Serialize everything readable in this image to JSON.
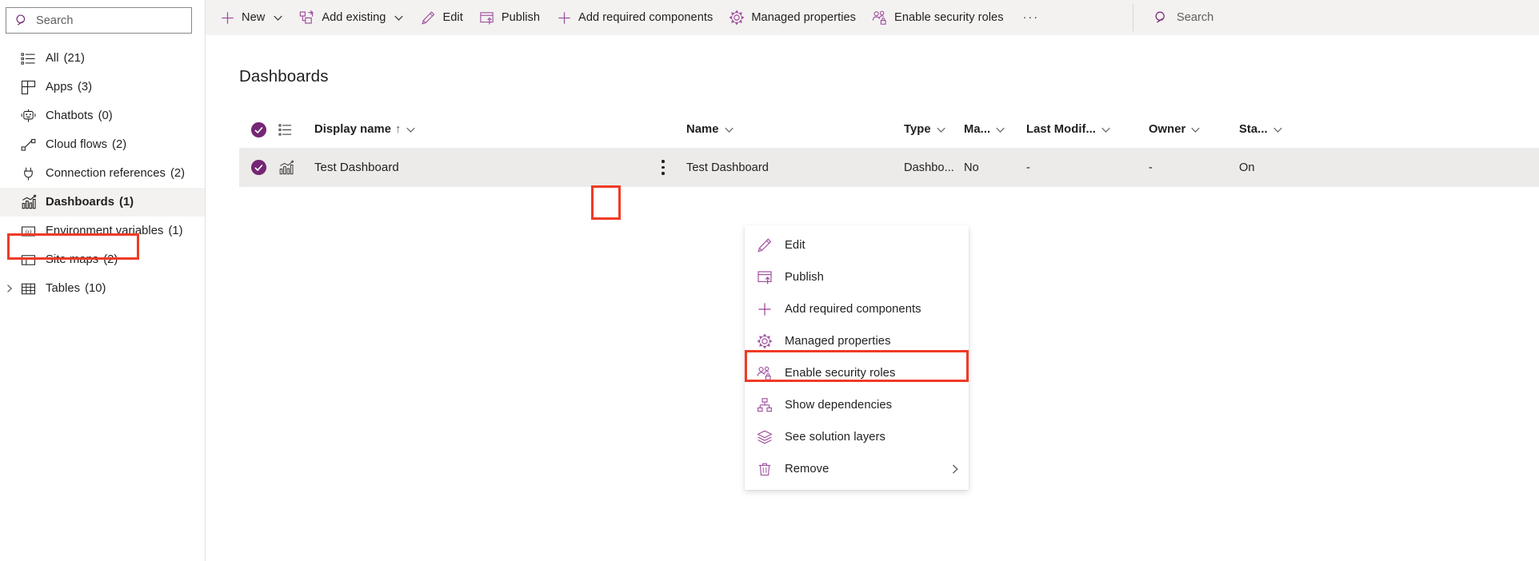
{
  "sidebar": {
    "search": {
      "placeholder": "Search",
      "icon": "search-icon"
    },
    "items": [
      {
        "label": "All",
        "count": "(21)",
        "icon": "list-icon",
        "selected": false
      },
      {
        "label": "Apps",
        "count": "(3)",
        "icon": "apps-grid-icon",
        "selected": false
      },
      {
        "label": "Chatbots",
        "count": "(0)",
        "icon": "chatbot-icon",
        "selected": false
      },
      {
        "label": "Cloud flows",
        "count": "(2)",
        "icon": "flow-icon",
        "selected": false
      },
      {
        "label": "Connection references",
        "count": "(2)",
        "icon": "plug-icon",
        "selected": false
      },
      {
        "label": "Dashboards",
        "count": "(1)",
        "icon": "dashboard-chart-icon",
        "selected": true
      },
      {
        "label": "Environment variables",
        "count": "(1)",
        "icon": "variable-icon",
        "selected": false
      },
      {
        "label": "Site maps",
        "count": "(2)",
        "icon": "sitemap-layout-icon",
        "selected": false
      },
      {
        "label": "Tables",
        "count": "(10)",
        "icon": "table-grid-icon",
        "selected": false,
        "expandable": true
      }
    ]
  },
  "commandbar": {
    "items": [
      {
        "label": "New",
        "icon": "plus-icon",
        "caret": true
      },
      {
        "label": "Add existing",
        "icon": "add-existing-icon",
        "caret": true
      },
      {
        "label": "Edit",
        "icon": "pencil-icon",
        "caret": false
      },
      {
        "label": "Publish",
        "icon": "publish-icon",
        "caret": false
      },
      {
        "label": "Add required components",
        "icon": "plus-icon",
        "caret": false
      },
      {
        "label": "Managed properties",
        "icon": "gear-icon",
        "caret": false
      },
      {
        "label": "Enable security roles",
        "icon": "security-roles-icon",
        "caret": false
      }
    ],
    "overflow_label": "···",
    "search": {
      "placeholder": "Search",
      "icon": "search-icon"
    }
  },
  "main": {
    "title": "Dashboards",
    "columns": [
      {
        "key": "display",
        "label": "Display name",
        "sorted": "↑",
        "caret": true
      },
      {
        "key": "name",
        "label": "Name",
        "caret": true
      },
      {
        "key": "type",
        "label": "Type",
        "caret": true
      },
      {
        "key": "ma",
        "label": "Ma...",
        "caret": true
      },
      {
        "key": "modified",
        "label": "Last Modif...",
        "caret": true
      },
      {
        "key": "owner",
        "label": "Owner",
        "caret": true
      },
      {
        "key": "status",
        "label": "Sta...",
        "caret": true
      }
    ],
    "rows": [
      {
        "selected": true,
        "row_icon": "dashboard-chart-icon",
        "display": "Test Dashboard",
        "name": "Test Dashboard",
        "type": "Dashbo...",
        "ma": "No",
        "modified": "-",
        "owner": "-",
        "status": "On"
      }
    ]
  },
  "context_menu": {
    "items": [
      {
        "label": "Edit",
        "icon": "pencil-icon",
        "highlighted": false,
        "submenu": false
      },
      {
        "label": "Publish",
        "icon": "publish-icon",
        "highlighted": false,
        "submenu": false
      },
      {
        "label": "Add required components",
        "icon": "plus-icon",
        "highlighted": false,
        "submenu": false
      },
      {
        "label": "Managed properties",
        "icon": "gear-icon",
        "highlighted": false,
        "submenu": false
      },
      {
        "label": "Enable security roles",
        "icon": "security-roles-icon",
        "highlighted": true,
        "submenu": false
      },
      {
        "label": "Show dependencies",
        "icon": "dependencies-icon",
        "highlighted": false,
        "submenu": false
      },
      {
        "label": "See solution layers",
        "icon": "layers-icon",
        "highlighted": false,
        "submenu": false
      },
      {
        "label": "Remove",
        "icon": "trash-icon",
        "highlighted": false,
        "submenu": true
      }
    ]
  },
  "colors": {
    "accent_purple": "#742774",
    "icon_purple": "#a0519f",
    "highlight_red": "#f03a26",
    "selected_row_bg": "#edebe9",
    "commandbar_bg": "#f3f2f1",
    "text": "#201f1e"
  }
}
